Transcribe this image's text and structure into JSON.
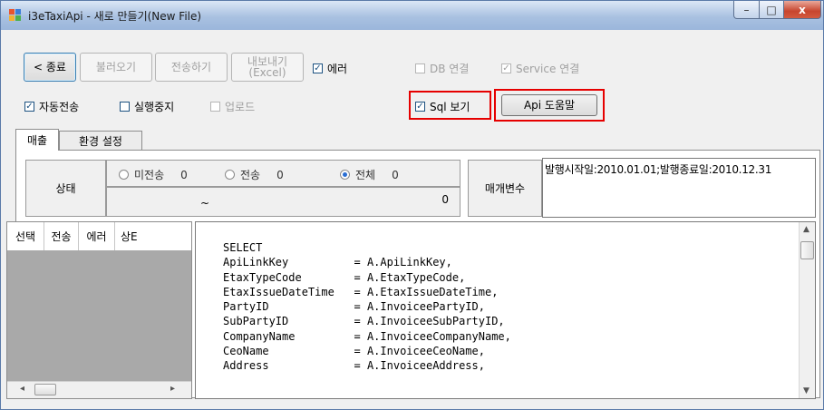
{
  "window": {
    "title": "i3eTaxiApi - 새로 만들기(New File)",
    "controls": {
      "minimize": "–",
      "maximize": "□",
      "close": "x"
    }
  },
  "toolbar": {
    "buttons": {
      "back": "< 종료",
      "load": "불러오기",
      "send": "전송하기",
      "export": "내보내기\n(Excel)",
      "api_help": "Api 도움말"
    },
    "checkboxes": {
      "error": {
        "label": "에러",
        "checked": true
      },
      "db_connect": {
        "label": "DB 연결",
        "checked": false
      },
      "service_connect": {
        "label": "Service 연결",
        "checked": true
      },
      "auto_send": {
        "label": "자동전송",
        "checked": true
      },
      "stop_exec": {
        "label": "실행중지",
        "checked": false
      },
      "upload": {
        "label": "업로드",
        "checked": false
      },
      "sql_view": {
        "label": "Sql 보기",
        "checked": true
      }
    }
  },
  "tabs": [
    "매출",
    "환경 설정"
  ],
  "status": {
    "label": "상태",
    "radios": [
      {
        "label": "미전송",
        "count": "0",
        "selected": false
      },
      {
        "label": "전송",
        "count": "0",
        "selected": false
      },
      {
        "label": "전체",
        "count": "0",
        "selected": true
      }
    ],
    "range_sep": "~",
    "total": "0"
  },
  "params": {
    "label": "매개변수",
    "value": "발행시작일:2010.01.01;발행종료일:2010.12.31"
  },
  "grid": {
    "headers": [
      "선택",
      "전송",
      "에러",
      "상E"
    ]
  },
  "sql": {
    "lines": [
      "SELECT",
      "ApiLinkKey          = A.ApiLinkKey,",
      "EtaxTypeCode        = A.EtaxTypeCode,",
      "EtaxIssueDateTime   = A.EtaxIssueDateTime,",
      "PartyID             = A.InvoiceePartyID,",
      "SubPartyID          = A.InvoiceeSubPartyID,",
      "CompanyName         = A.InvoiceeCompanyName,",
      "CeoName             = A.InvoiceeCeoName,",
      "Address             = A.InvoiceeAddress,"
    ]
  },
  "colors": {
    "highlight": "#e60000",
    "title_bar": "#a9c1e1",
    "panel_bg": "#f0f0f0",
    "grid_bg": "#a9a9a9"
  }
}
